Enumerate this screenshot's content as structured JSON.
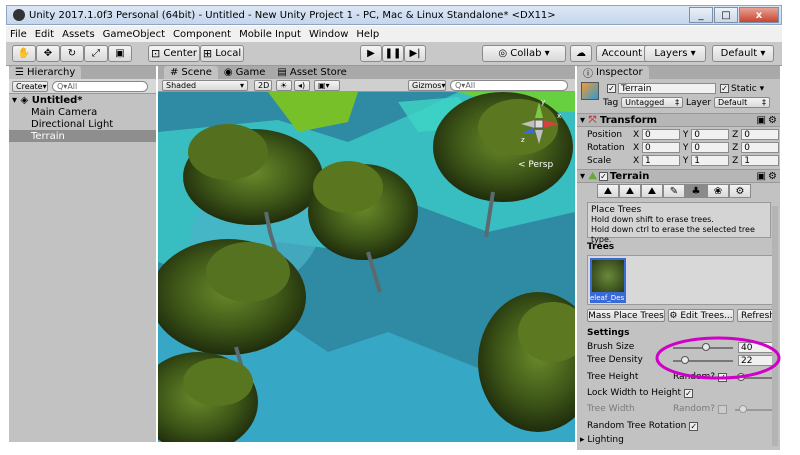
{
  "window": {
    "title": "Unity 2017.1.0f3 Personal (64bit) - Untitled - New Unity Project 1 - PC, Mac & Linux Standalone* <DX11>",
    "min": "_",
    "max": "□",
    "close": "x"
  },
  "menu": [
    "File",
    "Edit",
    "Assets",
    "GameObject",
    "Component",
    "Mobile Input",
    "Window",
    "Help"
  ],
  "toolbar": {
    "center": "Center",
    "local": "Local",
    "collab": "Collab",
    "account": "Account",
    "layers": "Layers",
    "layout": "Default"
  },
  "hierarchy": {
    "tab": "Hierarchy",
    "create": "Create",
    "search_placeholder": "Q▾All",
    "scene_name": "Untitled*",
    "items": [
      "Main Camera",
      "Directional Light",
      "Terrain"
    ]
  },
  "scene": {
    "tabs": [
      "Scene",
      "Game",
      "Asset Store"
    ],
    "shading": "Shaded",
    "mode_2d": "2D",
    "gizmos": "Gizmos",
    "search_placeholder": "Q▾All",
    "persp": "Persp",
    "axes": {
      "y": "y",
      "x": "x",
      "z": "z"
    }
  },
  "inspector": {
    "tab": "Inspector",
    "object_name": "Terrain",
    "static_label": "Static",
    "tag_label": "Tag",
    "tag_value": "Untagged",
    "layer_label": "Layer",
    "layer_value": "Default",
    "transform": {
      "title": "Transform",
      "rows": [
        {
          "label": "Position",
          "x": "0",
          "y": "0",
          "z": "0"
        },
        {
          "label": "Rotation",
          "x": "0",
          "y": "0",
          "z": "0"
        },
        {
          "label": "Scale",
          "x": "1",
          "y": "1",
          "z": "1"
        }
      ],
      "axis_x": "X",
      "axis_y": "Y",
      "axis_z": "Z"
    },
    "terrain": {
      "title": "Terrain",
      "tool_title": "Place Trees",
      "tool_line1": "Hold down shift to erase trees.",
      "tool_line2": "Hold down ctrl to erase the selected tree type.",
      "trees_label": "Trees",
      "tree_asset": "Broadleaf_Desktop",
      "tree_asset_short": "eleaf_Des",
      "mass_place": "Mass Place Trees",
      "edit_trees": "Edit Trees...",
      "refresh": "Refresh",
      "settings_label": "Settings",
      "brush_size_label": "Brush Size",
      "brush_size": "40",
      "brush_size_frac": 0.55,
      "tree_density_label": "Tree Density",
      "tree_density": "22",
      "tree_density_frac": 0.2,
      "tree_height_label": "Tree Height",
      "random_label": "Random?",
      "lock_width_label": "Lock Width to Height",
      "tree_width_label": "Tree Width",
      "random_label2": "Random?",
      "random_rotation_label": "Random Tree Rotation",
      "lighting_label": "Lighting"
    }
  },
  "colors": {
    "highlight_ellipse": "#d000c8",
    "water": "#3a8fa0",
    "tree_dark": "#2a3a14",
    "tree_light": "#5f7a24"
  }
}
